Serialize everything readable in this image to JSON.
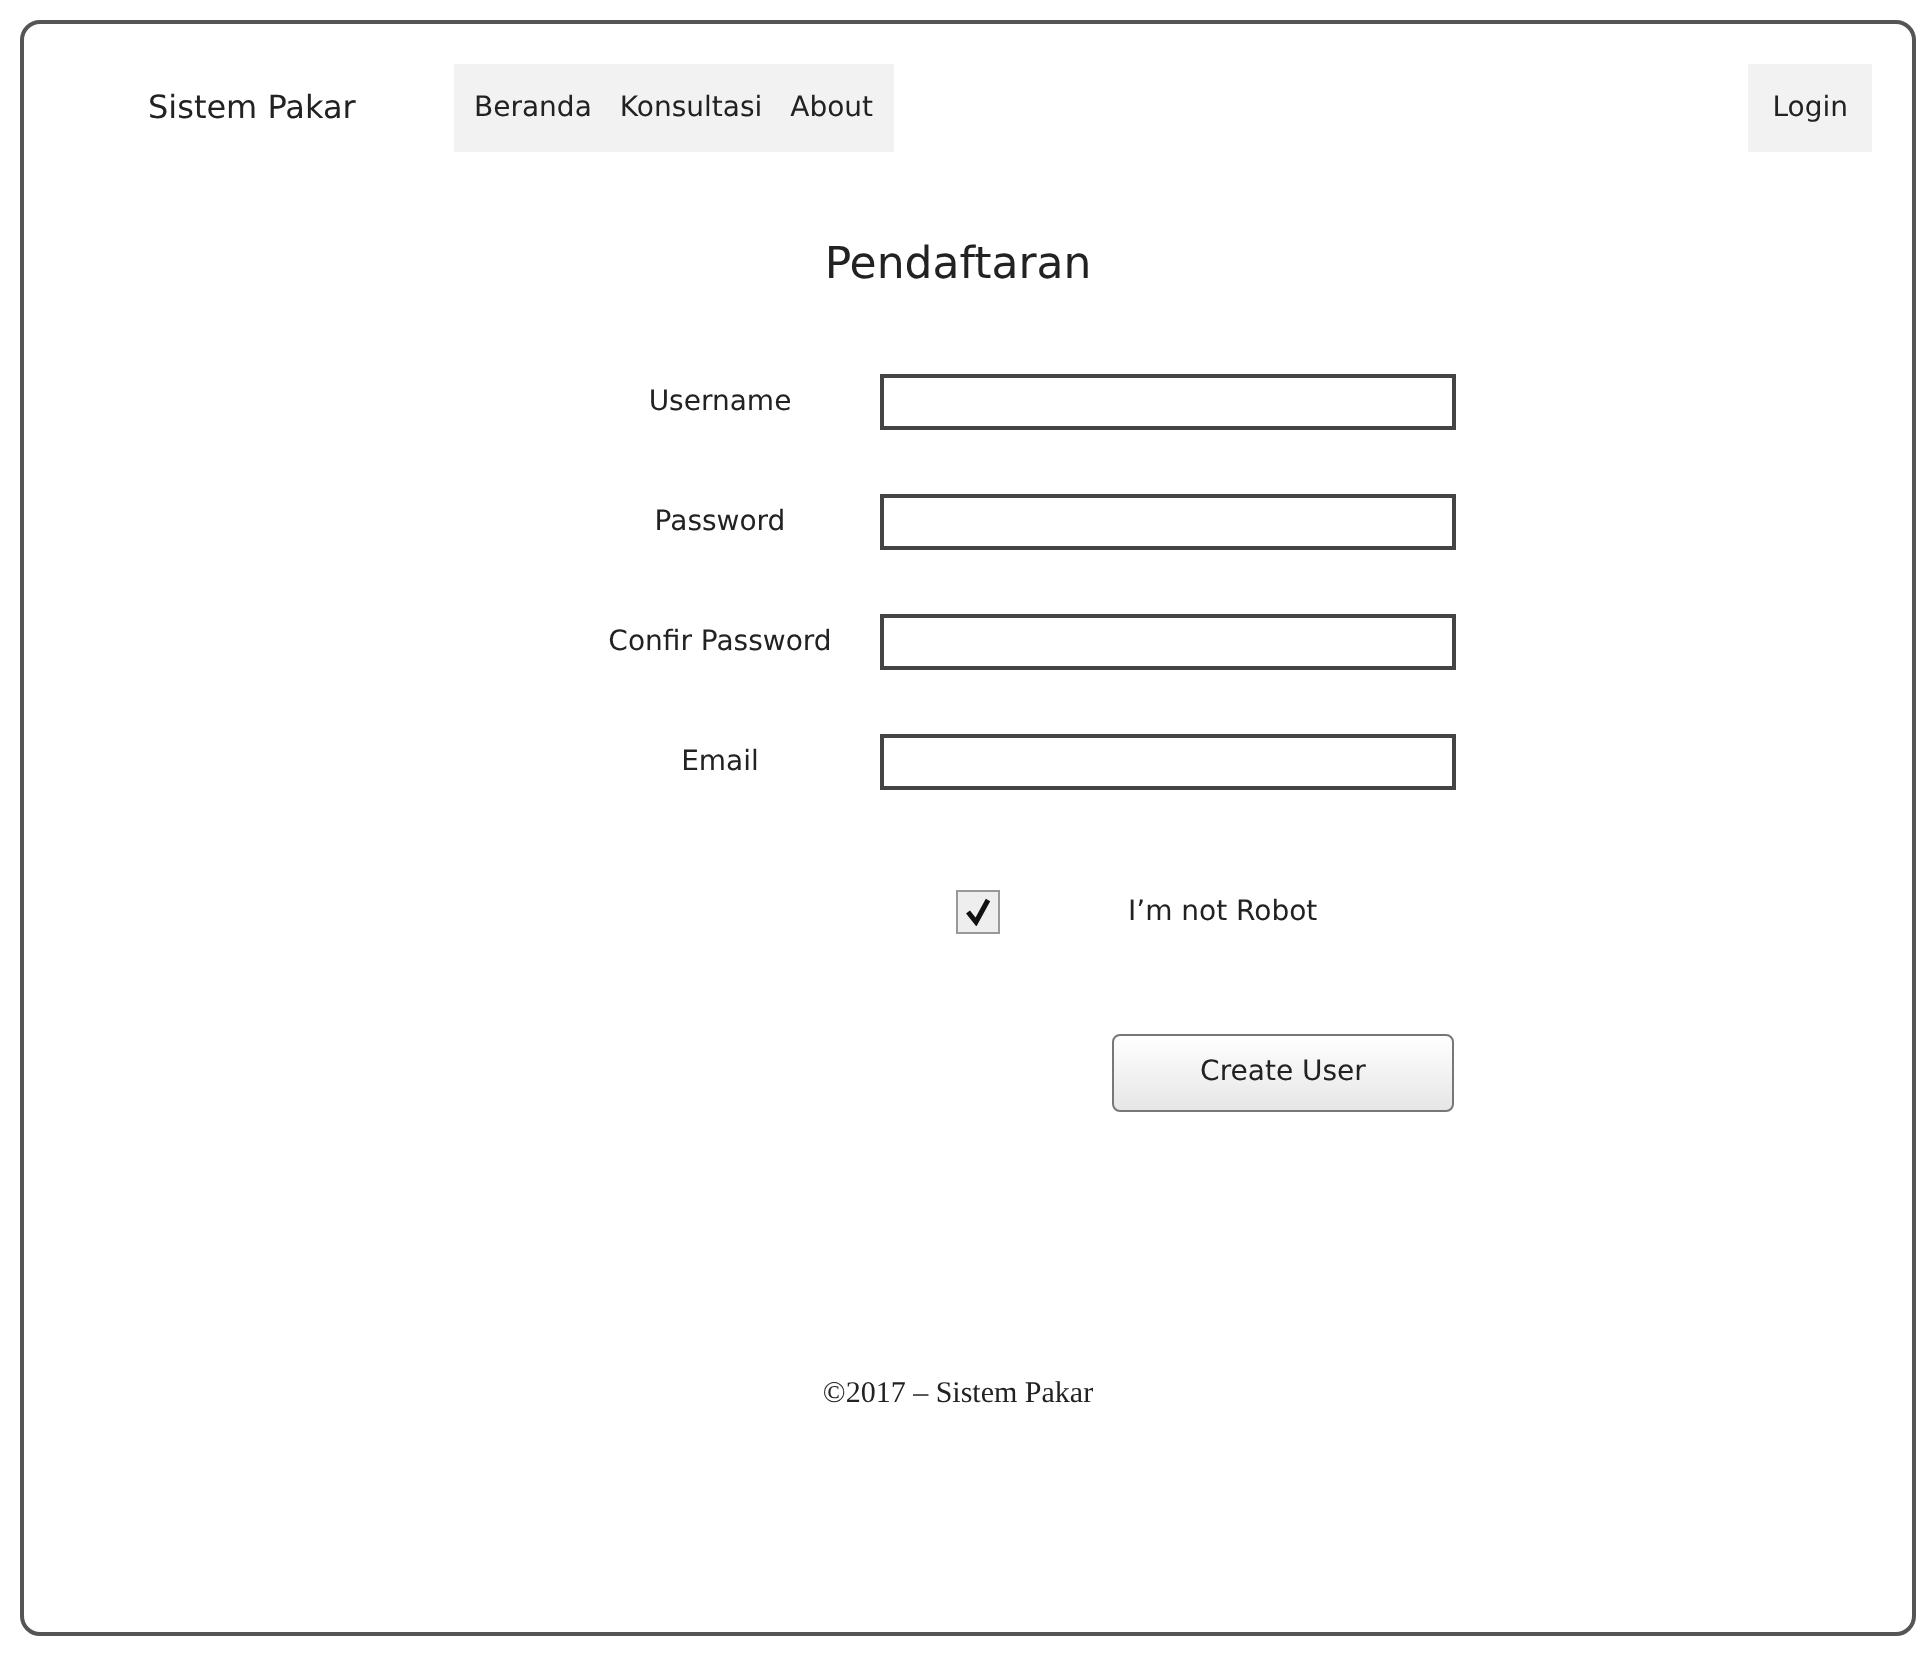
{
  "navbar": {
    "brand": "Sistem Pakar",
    "menu": [
      {
        "label": "Beranda"
      },
      {
        "label": "Konsultasi"
      },
      {
        "label": "About"
      }
    ],
    "login": "Login"
  },
  "form": {
    "title": "Pendaftaran",
    "fields": [
      {
        "label": "Username"
      },
      {
        "label": "Password"
      },
      {
        "label": "Confir Password"
      },
      {
        "label": "Email"
      }
    ],
    "checkbox": {
      "label": "I’m not Robot",
      "checked": true
    },
    "submit": "Create User"
  },
  "footer": "©2017 – Sistem Pakar"
}
